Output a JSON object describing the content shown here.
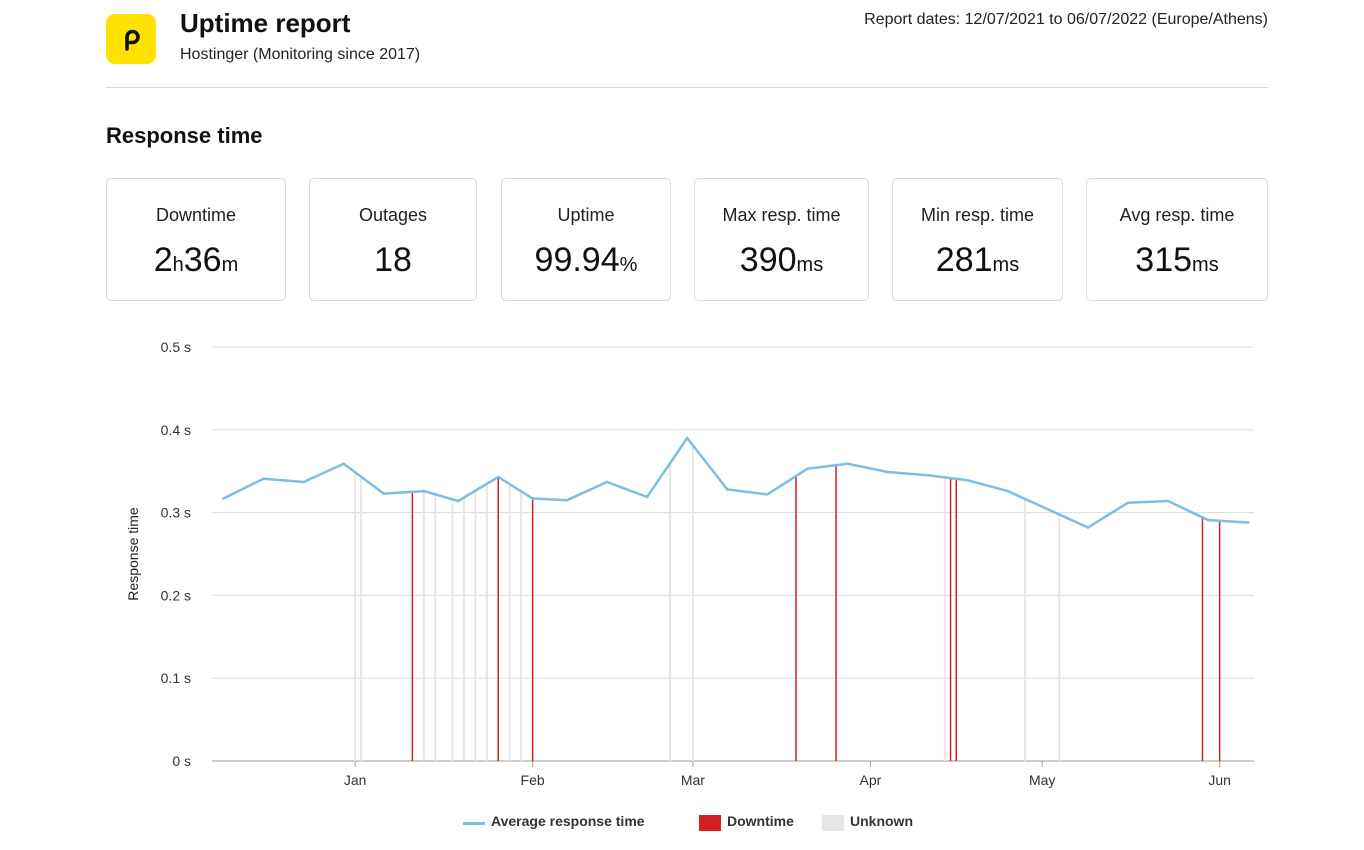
{
  "header": {
    "title": "Uptime report",
    "subtitle": "Hostinger (Monitoring since 2017)",
    "report_dates": "Report dates: 12/07/2021 to 06/07/2022 (Europe/Athens)",
    "logo_icon": "p-logo-icon",
    "logo_color": "#ffe200"
  },
  "section": {
    "title": "Response time"
  },
  "stats": [
    {
      "label": "Downtime",
      "value_a": "2",
      "unit_a": "h",
      "value_b": "36",
      "unit_b": "m"
    },
    {
      "label": "Outages",
      "value": "18",
      "unit": ""
    },
    {
      "label": "Uptime",
      "value": "99.94",
      "unit": "%"
    },
    {
      "label": "Max resp. time",
      "value": "390",
      "unit": "ms"
    },
    {
      "label": "Min resp. time",
      "value": "281",
      "unit": "ms"
    },
    {
      "label": "Avg resp. time",
      "value": "315",
      "unit": "ms"
    }
  ],
  "chart_data": {
    "type": "line",
    "ylabel": "Response time",
    "ylim": [
      0,
      0.5
    ],
    "yticks": [
      0,
      0.1,
      0.2,
      0.3,
      0.4,
      0.5
    ],
    "ytick_labels": [
      "0 s",
      "0.1 s",
      "0.2 s",
      "0.3 s",
      "0.4 s",
      "0.5 s"
    ],
    "xlim": [
      "2021-12-07",
      "2022-06-07"
    ],
    "xticks": [
      {
        "date": "2022-01-01",
        "label": "Jan"
      },
      {
        "date": "2022-02-01",
        "label": "Feb"
      },
      {
        "date": "2022-03-01",
        "label": "Mar"
      },
      {
        "date": "2022-04-01",
        "label": "Apr"
      },
      {
        "date": "2022-05-01",
        "label": "May"
      },
      {
        "date": "2022-06-01",
        "label": "Jun"
      }
    ],
    "grid": true,
    "legend_position": "bottom",
    "series": [
      {
        "name": "Average response time",
        "color": "#7cbde6",
        "points": [
          [
            "2021-12-09",
            0.317
          ],
          [
            "2021-12-16",
            0.341
          ],
          [
            "2021-12-23",
            0.337
          ],
          [
            "2021-12-30",
            0.359
          ],
          [
            "2022-01-06",
            0.323
          ],
          [
            "2022-01-13",
            0.326
          ],
          [
            "2022-01-19",
            0.314
          ],
          [
            "2022-01-26",
            0.343
          ],
          [
            "2022-02-01",
            0.317
          ],
          [
            "2022-02-07",
            0.315
          ],
          [
            "2022-02-14",
            0.337
          ],
          [
            "2022-02-21",
            0.319
          ],
          [
            "2022-02-28",
            0.39
          ],
          [
            "2022-03-07",
            0.328
          ],
          [
            "2022-03-14",
            0.322
          ],
          [
            "2022-03-21",
            0.353
          ],
          [
            "2022-03-28",
            0.359
          ],
          [
            "2022-04-04",
            0.349
          ],
          [
            "2022-04-11",
            0.345
          ],
          [
            "2022-04-18",
            0.339
          ],
          [
            "2022-04-25",
            0.326
          ],
          [
            "2022-05-02",
            0.304
          ],
          [
            "2022-05-09",
            0.282
          ],
          [
            "2022-05-16",
            0.312
          ],
          [
            "2022-05-23",
            0.314
          ],
          [
            "2022-05-30",
            0.291
          ],
          [
            "2022-06-06",
            0.288
          ]
        ]
      }
    ],
    "downtime": {
      "name": "Downtime",
      "color": "#d42020",
      "dates": [
        "2022-01-11",
        "2022-01-26",
        "2022-02-01",
        "2022-03-19",
        "2022-03-26",
        "2022-04-15",
        "2022-04-16",
        "2022-05-29",
        "2022-06-01"
      ]
    },
    "unknown": {
      "name": "Unknown",
      "color": "#e6e6e6",
      "dates": [
        "2022-01-01",
        "2022-01-02",
        "2022-01-13",
        "2022-01-15",
        "2022-01-18",
        "2022-01-20",
        "2022-01-22",
        "2022-01-24",
        "2022-01-28",
        "2022-01-30",
        "2022-02-25",
        "2022-03-01",
        "2022-04-14",
        "2022-04-28",
        "2022-05-04"
      ]
    }
  }
}
